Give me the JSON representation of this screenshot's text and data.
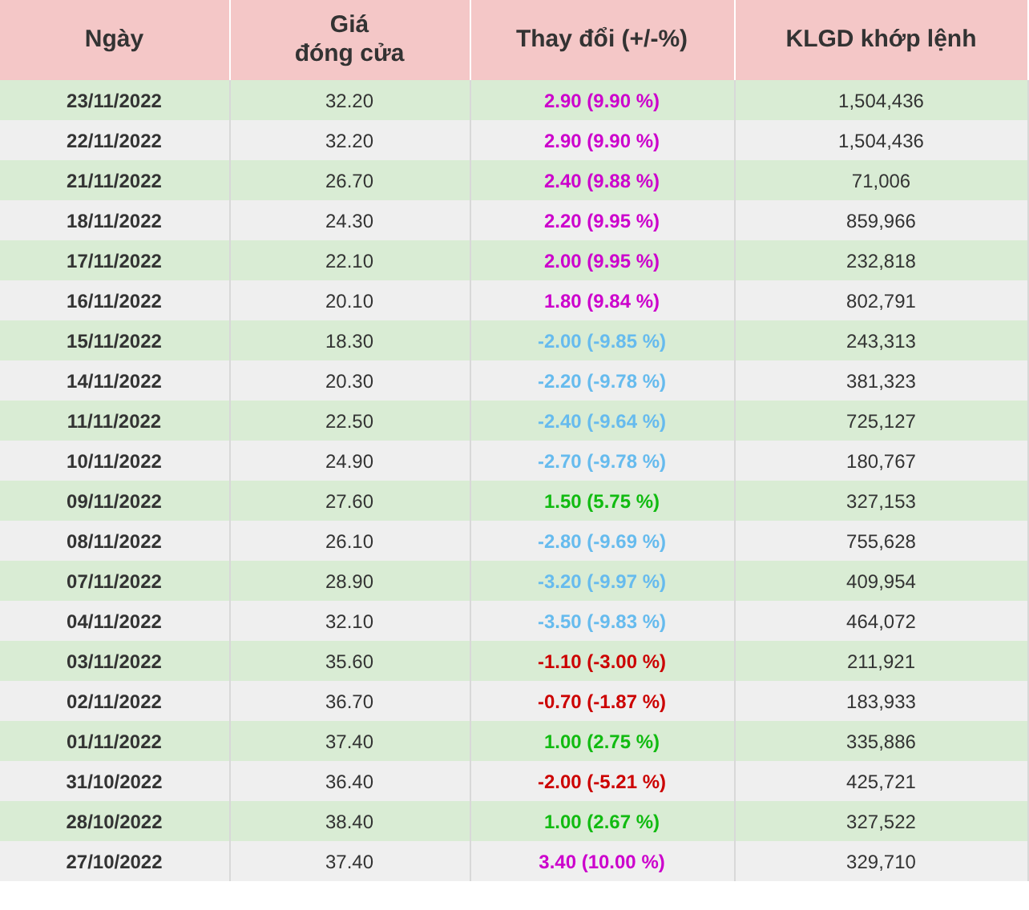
{
  "table": {
    "columns": [
      "Ngày",
      "Giá\nđóng cửa",
      "Thay đổi (+/-%)",
      "KLGD khớp lệnh"
    ],
    "rows": [
      {
        "date": "23/11/2022",
        "close": "32.20",
        "change": "2.90 (9.90 %)",
        "color": "#cc00cc",
        "volume": "1,504,436"
      },
      {
        "date": "22/11/2022",
        "close": "32.20",
        "change": "2.90 (9.90 %)",
        "color": "#cc00cc",
        "volume": "1,504,436"
      },
      {
        "date": "21/11/2022",
        "close": "26.70",
        "change": "2.40 (9.88 %)",
        "color": "#cc00cc",
        "volume": "71,006"
      },
      {
        "date": "18/11/2022",
        "close": "24.30",
        "change": "2.20 (9.95 %)",
        "color": "#cc00cc",
        "volume": "859,966"
      },
      {
        "date": "17/11/2022",
        "close": "22.10",
        "change": "2.00 (9.95 %)",
        "color": "#cc00cc",
        "volume": "232,818"
      },
      {
        "date": "16/11/2022",
        "close": "20.10",
        "change": "1.80 (9.84 %)",
        "color": "#cc00cc",
        "volume": "802,791"
      },
      {
        "date": "15/11/2022",
        "close": "18.30",
        "change": "-2.00 (-9.85 %)",
        "color": "#66bbee",
        "volume": "243,313"
      },
      {
        "date": "14/11/2022",
        "close": "20.30",
        "change": "-2.20 (-9.78 %)",
        "color": "#66bbee",
        "volume": "381,323"
      },
      {
        "date": "11/11/2022",
        "close": "22.50",
        "change": "-2.40 (-9.64 %)",
        "color": "#66bbee",
        "volume": "725,127"
      },
      {
        "date": "10/11/2022",
        "close": "24.90",
        "change": "-2.70 (-9.78 %)",
        "color": "#66bbee",
        "volume": "180,767"
      },
      {
        "date": "09/11/2022",
        "close": "27.60",
        "change": "1.50 (5.75 %)",
        "color": "#11bb11",
        "volume": "327,153"
      },
      {
        "date": "08/11/2022",
        "close": "26.10",
        "change": "-2.80 (-9.69 %)",
        "color": "#66bbee",
        "volume": "755,628"
      },
      {
        "date": "07/11/2022",
        "close": "28.90",
        "change": "-3.20 (-9.97 %)",
        "color": "#66bbee",
        "volume": "409,954"
      },
      {
        "date": "04/11/2022",
        "close": "32.10",
        "change": "-3.50 (-9.83 %)",
        "color": "#66bbee",
        "volume": "464,072"
      },
      {
        "date": "03/11/2022",
        "close": "35.60",
        "change": "-1.10 (-3.00 %)",
        "color": "#cc0000",
        "volume": "211,921"
      },
      {
        "date": "02/11/2022",
        "close": "36.70",
        "change": "-0.70 (-1.87 %)",
        "color": "#cc0000",
        "volume": "183,933"
      },
      {
        "date": "01/11/2022",
        "close": "37.40",
        "change": "1.00 (2.75 %)",
        "color": "#11bb11",
        "volume": "335,886"
      },
      {
        "date": "31/10/2022",
        "close": "36.40",
        "change": "-2.00 (-5.21 %)",
        "color": "#cc0000",
        "volume": "425,721"
      },
      {
        "date": "28/10/2022",
        "close": "38.40",
        "change": "1.00 (2.67 %)",
        "color": "#11bb11",
        "volume": "327,522"
      },
      {
        "date": "27/10/2022",
        "close": "37.40",
        "change": "3.40 (10.00 %)",
        "color": "#cc00cc",
        "volume": "329,710"
      }
    ]
  }
}
